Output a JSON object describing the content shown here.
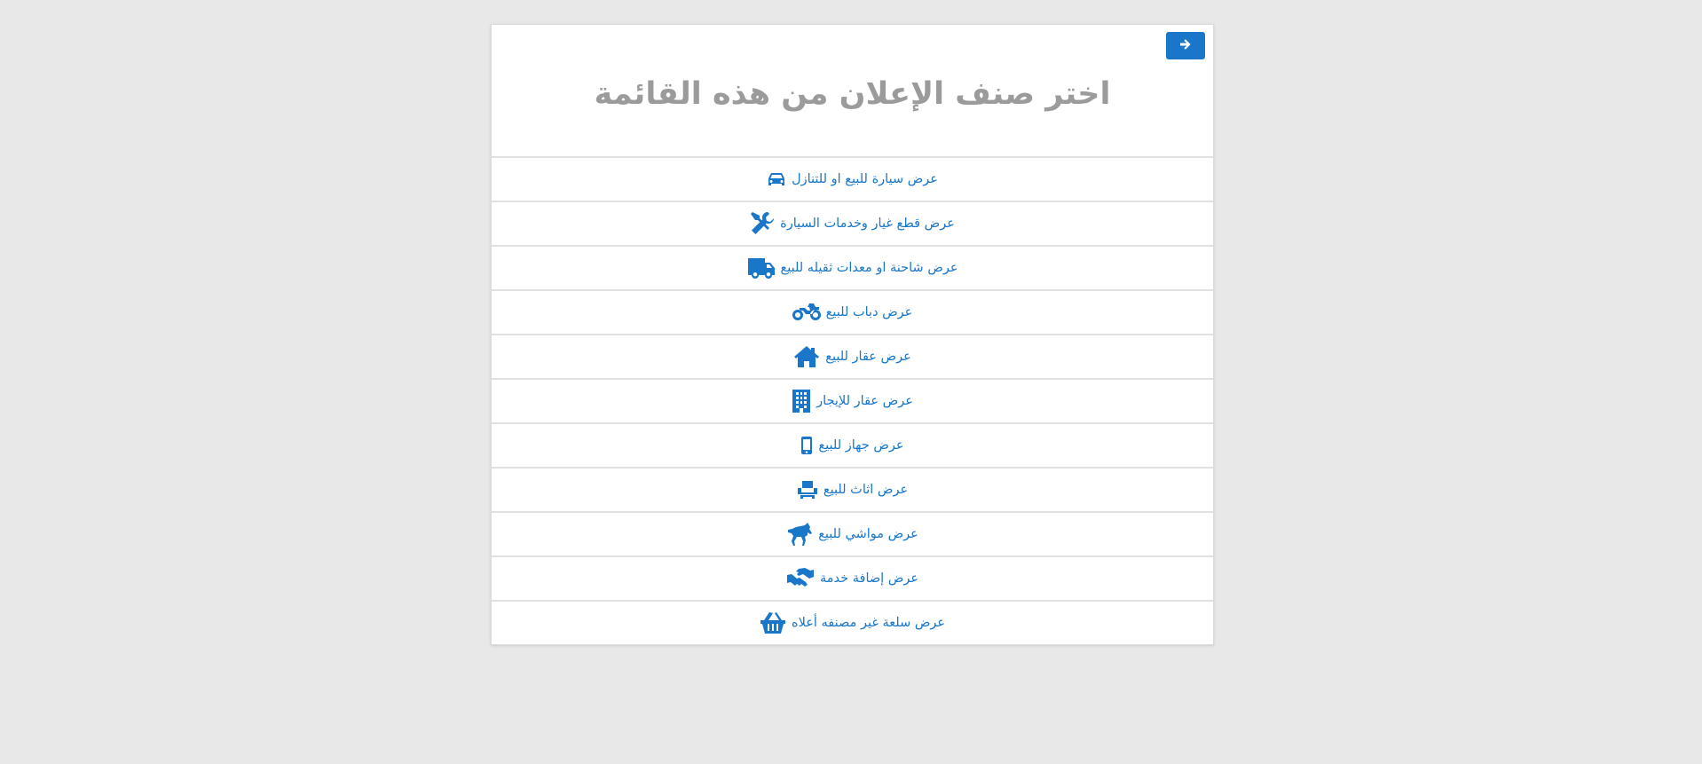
{
  "back_button": {
    "icon": "arrow-right-icon"
  },
  "page_title": "اختر صنف الإعلان  من هذه القائمة",
  "accent_color": "#1976c9",
  "categories": [
    {
      "label": "عرض سيارة للبيع او للتنازل",
      "icon": "car-icon"
    },
    {
      "label": "عرض قطع غيار وخدمات السيارة",
      "icon": "wrench-screwdriver-icon"
    },
    {
      "label": "عرض شاحنة او معدات ثقيله للبيع",
      "icon": "truck-icon"
    },
    {
      "label": "عرض دباب للبيع",
      "icon": "motorcycle-icon"
    },
    {
      "label": "عرض عقار للبيع",
      "icon": "house-icon"
    },
    {
      "label": "عرض عقار للإيجار",
      "icon": "building-icon"
    },
    {
      "label": "عرض جهاز للبيع",
      "icon": "mobile-phone-icon"
    },
    {
      "label": "عرض اثاث للبيع",
      "icon": "armchair-icon"
    },
    {
      "label": "عرض مواشي للبيع",
      "icon": "horse-icon"
    },
    {
      "label": "عرض إضافة خدمة",
      "icon": "handshake-icon"
    },
    {
      "label": "عرض سلعة غير مصنفه أعلاه",
      "icon": "basket-icon"
    }
  ]
}
